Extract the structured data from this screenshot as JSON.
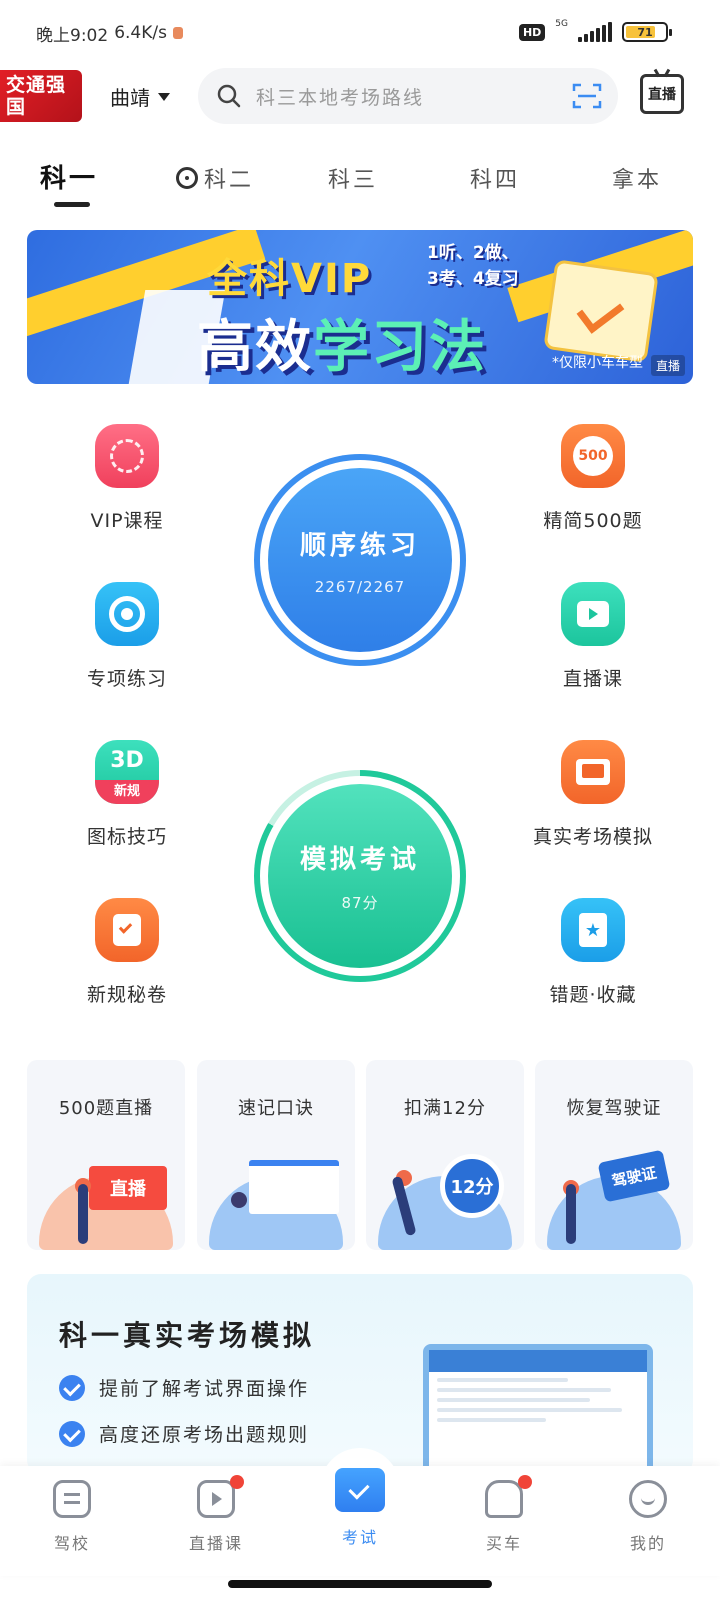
{
  "status_bar": {
    "time": "晚上9:02",
    "speed": "6.4K/s",
    "hd": "HD",
    "network": "5G",
    "battery": "71"
  },
  "header": {
    "logo_text": "交通强国",
    "city": "曲靖",
    "search_placeholder": "科三本地考场路线",
    "live_label": "直播"
  },
  "tabs": [
    "科一",
    "科二",
    "科三",
    "科四",
    "拿本"
  ],
  "banner": {
    "title_line1_a": "全科",
    "title_line1_b": "VIP",
    "subtitle_line1": "1听、2做、",
    "subtitle_line2": "3考、4复习",
    "title_line2_a": "高效",
    "title_line2_b": "学习法",
    "note": "*仅限小车车型",
    "tag": "直播"
  },
  "features": {
    "vip_course": "VIP课程",
    "special_practice": "专项练习",
    "sign_tips": "图标技巧",
    "new_rules_paper": "新规秘卷",
    "selected_500": "精简500题",
    "live_course": "直播课",
    "real_exam": "真实考场模拟",
    "wrong_saved": "错题·收藏",
    "badge_500": "500",
    "badge_new": "新规"
  },
  "sequence_practice": {
    "title": "顺序练习",
    "progress": "2267/2267"
  },
  "mock_exam": {
    "title": "模拟考试",
    "score": "87分"
  },
  "cards": [
    {
      "title": "500题直播",
      "tag": "直播"
    },
    {
      "title": "速记口诀"
    },
    {
      "title": "扣满12分",
      "tag": "12分"
    },
    {
      "title": "恢复驾驶证",
      "tag": "驾驶证"
    }
  ],
  "promo": {
    "title": "科一真实考场模拟",
    "point1": "提前了解考试界面操作",
    "point2": "高度还原考场出题规则"
  },
  "bottom_nav": [
    {
      "label": "驾校"
    },
    {
      "label": "直播课"
    },
    {
      "label": "考试"
    },
    {
      "label": "买车"
    },
    {
      "label": "我的"
    }
  ],
  "colors": {
    "accent_blue": "#3b8cf2",
    "mint": "#2fd3a8",
    "red": "#f04438"
  }
}
